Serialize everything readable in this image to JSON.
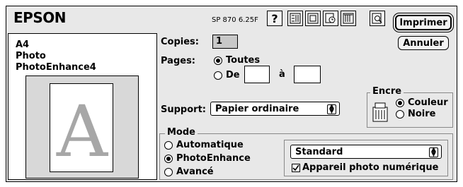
{
  "header": {
    "brand": "EPSON",
    "printer_model": "SP 870 6.25F",
    "help_label": "?"
  },
  "actions": {
    "print_label": "Imprimer",
    "cancel_label": "Annuler"
  },
  "summary": {
    "lines": [
      "A4",
      "Photo",
      "PhotoEnhance4"
    ],
    "preview_letter": "A"
  },
  "copies": {
    "label": "Copies:",
    "value": "1"
  },
  "pages": {
    "label": "Pages:",
    "all_label": "Toutes",
    "all_selected": true,
    "from_label": "De",
    "to_label": "à",
    "from_value": "",
    "to_value": ""
  },
  "support": {
    "label": "Support:",
    "value": "Papier ordinaire"
  },
  "ink": {
    "legend": "Encre",
    "options": [
      {
        "label": "Couleur",
        "selected": true
      },
      {
        "label": "Noire",
        "selected": false
      }
    ]
  },
  "mode": {
    "legend": "Mode",
    "options": [
      {
        "label": "Automatique",
        "selected": false
      },
      {
        "label": "PhotoEnhance",
        "selected": true
      },
      {
        "label": "Avancé",
        "selected": false
      }
    ],
    "preset_value": "Standard",
    "camera_label": "Appareil photo numérique",
    "camera_checked": true
  },
  "icons": [
    "help-icon",
    "utility-icon",
    "layout-icon",
    "background-print-icon",
    "status-monitor-icon",
    "preview-icon",
    "ink-cartridge-icon"
  ]
}
